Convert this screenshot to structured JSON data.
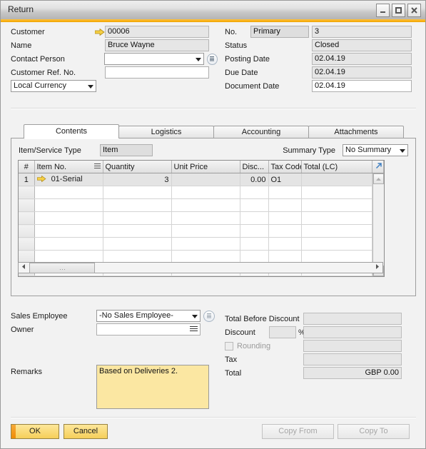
{
  "window": {
    "title": "Return",
    "buttons": {
      "minimize": "minimize-icon",
      "maximize": "maximize-icon",
      "close": "close-icon"
    }
  },
  "header_left": {
    "customer_label": "Customer",
    "customer_value": "00006",
    "name_label": "Name",
    "name_value": "Bruce Wayne",
    "contact_person_label": "Contact Person",
    "contact_person_value": "",
    "customer_ref_label": "Customer Ref. No.",
    "customer_ref_value": "",
    "currency_value": "Local Currency"
  },
  "header_right": {
    "no_label": "No.",
    "no_series": "Primary",
    "no_value": "3",
    "status_label": "Status",
    "status_value": "Closed",
    "posting_date_label": "Posting Date",
    "posting_date_value": "02.04.19",
    "due_date_label": "Due Date",
    "due_date_value": "02.04.19",
    "document_date_label": "Document Date",
    "document_date_value": "02.04.19"
  },
  "tabs": [
    {
      "label": "Contents",
      "active": true
    },
    {
      "label": "Logistics",
      "active": false
    },
    {
      "label": "Accounting",
      "active": false
    },
    {
      "label": "Attachments",
      "active": false
    }
  ],
  "contents": {
    "item_service_type_label": "Item/Service Type",
    "item_service_type_value": "Item",
    "summary_type_label": "Summary Type",
    "summary_type_value": "No Summary",
    "columns": [
      "#",
      "Item No.",
      "Quantity",
      "Unit Price",
      "Disc...",
      "Tax Code",
      "Total (LC)"
    ],
    "rows": [
      {
        "num": "1",
        "item_no": "01-Serial",
        "quantity": "3",
        "unit_price": "",
        "discount": "0.00",
        "tax_code": "O1",
        "total": ""
      }
    ],
    "empty_row_count": 7
  },
  "bottom_left": {
    "sales_employee_label": "Sales Employee",
    "sales_employee_value": "-No Sales Employee-",
    "owner_label": "Owner",
    "owner_value": ""
  },
  "totals": {
    "total_before_discount_label": "Total Before Discount",
    "total_before_discount_value": "",
    "discount_label": "Discount",
    "discount_value": "",
    "percent_symbol": "%",
    "discount_amount_value": "",
    "rounding_label": "Rounding",
    "rounding_value": "",
    "tax_label": "Tax",
    "tax_value": "",
    "total_label": "Total",
    "total_value": "GBP 0.00"
  },
  "remarks": {
    "label": "Remarks",
    "value": "Based on Deliveries 2."
  },
  "footer": {
    "ok_label": "OK",
    "cancel_label": "Cancel",
    "copy_from_label": "Copy From",
    "copy_to_label": "Copy To"
  },
  "colors": {
    "accent": "#f5a623",
    "remarks_bg": "#fbe7a2",
    "button_yellow": "#f6cf5a",
    "link_arrow": "#f0c419"
  }
}
